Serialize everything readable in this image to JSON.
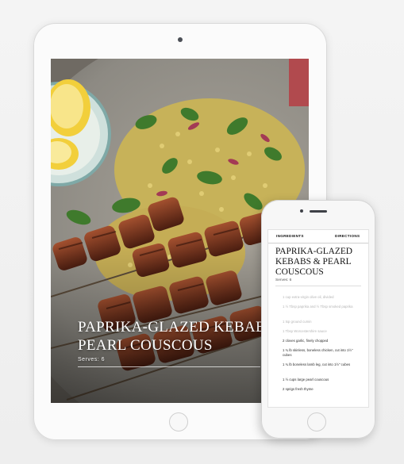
{
  "recipe": {
    "title": "PAPRIKA-GLAZED KEBABS & PEARL COUSCOUS",
    "ipad_title": "PAPRIKA-GLAZED KEBABS & PEARL COUSCOUS",
    "ipad_serves": "Serves: 6",
    "serves_label": "Serves: 6"
  },
  "phone": {
    "tabs": [
      {
        "label": "INGREDIENTS"
      },
      {
        "label": "DIRECTIONS"
      }
    ],
    "ingredients": [
      {
        "text": "1 cup extra-virgin olive oil, divided",
        "state": "faded"
      },
      {
        "text": "1 ½ Tbsp paprika and ½ Tbsp smoked paprika",
        "state": "faded"
      },
      {
        "text": "1 tsp ground cumin",
        "state": "faded"
      },
      {
        "text": "1 Tbsp Worcestershire sauce",
        "state": "faded"
      },
      {
        "text": "2 cloves garlic, finely chopped",
        "state": "active"
      },
      {
        "text": "1 ¾ lb skinless, boneless chicken, cut into 1½\" cubes",
        "state": "active"
      },
      {
        "text": "1 ¾ lb boneless lamb leg, cut into 1½\" cubes",
        "state": "active"
      },
      {
        "text": "1 ½ cups large pearl couscous",
        "state": "active"
      },
      {
        "text": "2 sprigs fresh thyme",
        "state": "active"
      }
    ]
  }
}
